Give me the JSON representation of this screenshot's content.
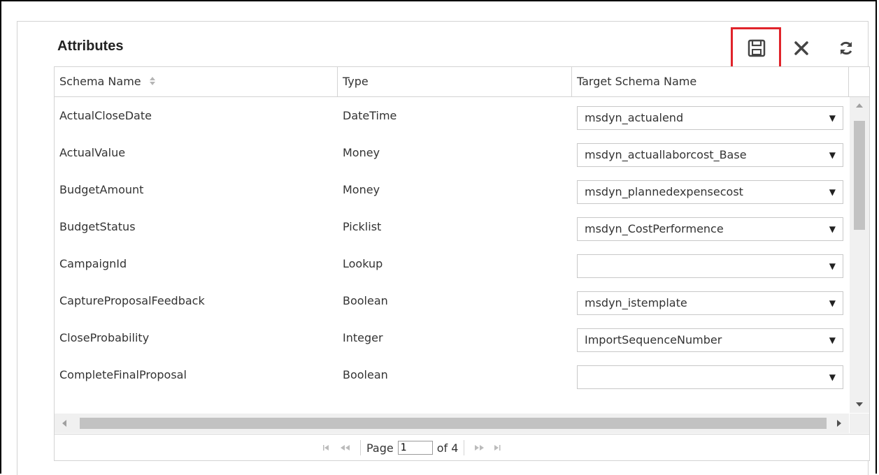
{
  "panel": {
    "title": "Attributes"
  },
  "toolbar": {
    "save_icon": "save-icon",
    "close_icon": "close-icon",
    "refresh_icon": "refresh-icon",
    "highlight_color": "#e0242b"
  },
  "grid": {
    "columns": [
      "Schema Name",
      "Type",
      "Target Schema Name"
    ],
    "sort_icon": "sort-icon",
    "rows": [
      {
        "schema_name": "ActualCloseDate",
        "type": "DateTime",
        "target": "msdyn_actualend"
      },
      {
        "schema_name": "ActualValue",
        "type": "Money",
        "target": "msdyn_actuallaborcost_Base"
      },
      {
        "schema_name": "BudgetAmount",
        "type": "Money",
        "target": "msdyn_plannedexpensecost"
      },
      {
        "schema_name": "BudgetStatus",
        "type": "Picklist",
        "target": "msdyn_CostPerformence"
      },
      {
        "schema_name": "CampaignId",
        "type": "Lookup",
        "target": ""
      },
      {
        "schema_name": "CaptureProposalFeedback",
        "type": "Boolean",
        "target": "msdyn_istemplate"
      },
      {
        "schema_name": "CloseProbability",
        "type": "Integer",
        "target": "ImportSequenceNumber"
      },
      {
        "schema_name": "CompleteFinalProposal",
        "type": "Boolean",
        "target": ""
      }
    ]
  },
  "pager": {
    "page_label": "Page",
    "current_page": "1",
    "of_label": "of 4"
  }
}
